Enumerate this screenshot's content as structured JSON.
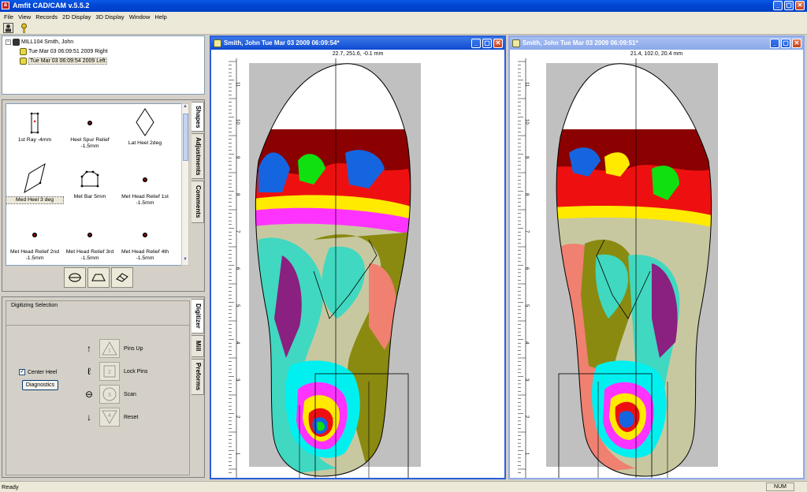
{
  "app": {
    "title": "Amfit CAD/CAM v.5.5.2",
    "icon_letter": "a"
  },
  "window_controls": {
    "minimize": "_",
    "restore": "▢",
    "close": "✕"
  },
  "menu": [
    "File",
    "View",
    "Records",
    "2D Display",
    "3D Display",
    "Window",
    "Help"
  ],
  "toolbar": {
    "icons": [
      "patient-icon",
      "key-icon"
    ]
  },
  "tree": {
    "patient": "MILL104  Smith, John",
    "scans": [
      {
        "label": "Tue Mar 03 06:09:51 2009 Right",
        "selected": false
      },
      {
        "label": "Tue Mar 03 06:09:54 2009 Left",
        "selected": true
      }
    ]
  },
  "shapes": {
    "items": [
      {
        "label": "1st Ray -4mm",
        "icon": "ray-rect-icon"
      },
      {
        "label": "Heel Spur Relief -1.5mm",
        "icon": "dot-icon"
      },
      {
        "label": "Lat Heel 2deg",
        "icon": "diamond-icon"
      },
      {
        "label": "Med Heel 3 deg",
        "icon": "slanted-diamond-icon",
        "selected": true
      },
      {
        "label": "Met Bar 5mm",
        "icon": "met-bar-icon"
      },
      {
        "label": "Met Head Relief 1st -1.5mm",
        "icon": "dot-icon"
      },
      {
        "label": "Met Head Relief 2nd -1.5mm",
        "icon": "dot-icon"
      },
      {
        "label": "Met Head Relief 3rd -1.5mm",
        "icon": "dot-icon"
      },
      {
        "label": "Met Head Relief 4th -1.5mm",
        "icon": "dot-icon"
      }
    ],
    "tabs": [
      "Shapes",
      "Adjustments",
      "Comments"
    ],
    "tools": [
      "level-icon",
      "trapezoid-icon",
      "eraser-icon"
    ]
  },
  "digitizer": {
    "legend": "Digitizing Selection",
    "center_heel_label": "Center Heel",
    "center_heel_checked": true,
    "diagnostics_label": "Diagnostics",
    "steps": [
      {
        "num": "1",
        "label": "Pins Up",
        "glyph": "↑"
      },
      {
        "num": "2",
        "label": "Lock Pins",
        "glyph": "ℓ"
      },
      {
        "num": "3",
        "label": "Scan",
        "glyph": "⊖"
      },
      {
        "num": "4",
        "label": "Reset",
        "glyph": "↓"
      }
    ],
    "tabs": [
      "Digitizer",
      "Mill",
      "Preforms"
    ]
  },
  "left_foot_window": {
    "title": "Smith, John  Tue Mar 03 2009 06:09:54*",
    "coord": "22.7, 251.6, -0.1 mm",
    "active": true
  },
  "right_foot_window": {
    "title": "Smith, John  Tue Mar 03 2009 06:09:51*",
    "coord": "21.4, 102.0, 20.4 mm",
    "active": false
  },
  "ruler_labels": [
    "11",
    "10",
    "9",
    "8",
    "7",
    "6",
    "5",
    "4",
    "3",
    "2",
    "1",
    "0"
  ],
  "status": {
    "ready": "Ready",
    "num": "NUM"
  },
  "colors": {
    "brand_title": "#0047d5",
    "heat_red": "#ee1010",
    "heat_darkred": "#8b0000",
    "heat_blue": "#1565e0",
    "heat_green": "#10e010",
    "heat_yellow": "#ffea00",
    "heat_magenta": "#ff33ff",
    "heat_cyan": "#00f0f0",
    "heat_olive": "#8a8a10",
    "heat_aqua": "#40d8c0",
    "heat_purple": "#8a2080",
    "heat_salmon": "#f08070",
    "heat_teal": "#208880"
  }
}
